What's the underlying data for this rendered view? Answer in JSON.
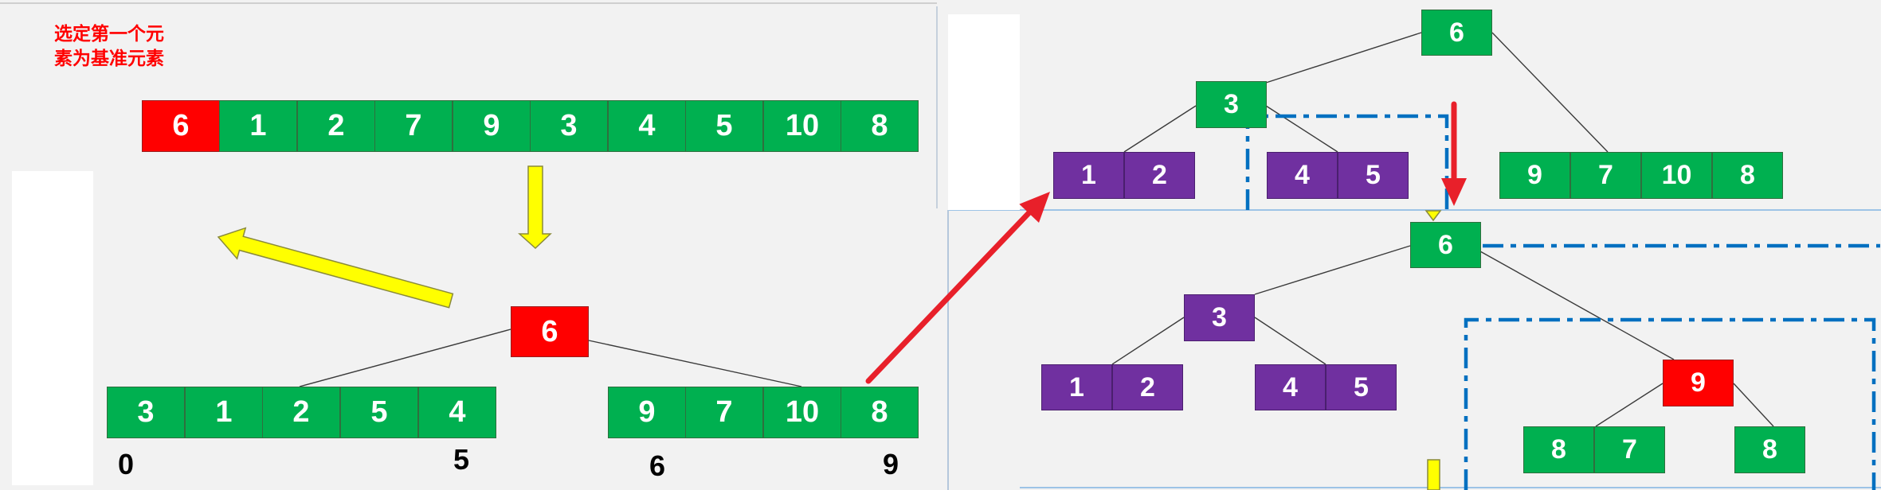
{
  "caption": {
    "line1": "选定第一个元",
    "line2": "素为基准元素"
  },
  "colors": {
    "pivot": "#ff0000",
    "element": "#00b050",
    "finished_subtree": "#7030a0",
    "flow_arrow": "#ffff00",
    "step_arrow": "#e8202a",
    "focus_box": "#0070c0"
  },
  "initial_array": [
    6,
    1,
    2,
    7,
    9,
    3,
    4,
    5,
    10,
    8
  ],
  "first_partition": {
    "pivot": 6,
    "left": [
      3,
      1,
      2,
      5,
      4
    ],
    "right": [
      9,
      7,
      10,
      8
    ],
    "indices": {
      "left_start": 0,
      "left_end": 5,
      "right_start": 6,
      "right_end": 9
    }
  },
  "tree_stage_1": {
    "root": 6,
    "left": {
      "node": 3,
      "left": [
        1,
        2
      ],
      "right": [
        4,
        5
      ]
    },
    "right": [
      9,
      7,
      10,
      8
    ]
  },
  "tree_stage_2": {
    "root": 6,
    "left": {
      "node": 3,
      "left": [
        1,
        2
      ],
      "right": [
        4,
        5
      ]
    },
    "right": {
      "node": 9,
      "left": [
        8,
        7
      ],
      "right": [
        8
      ]
    }
  }
}
